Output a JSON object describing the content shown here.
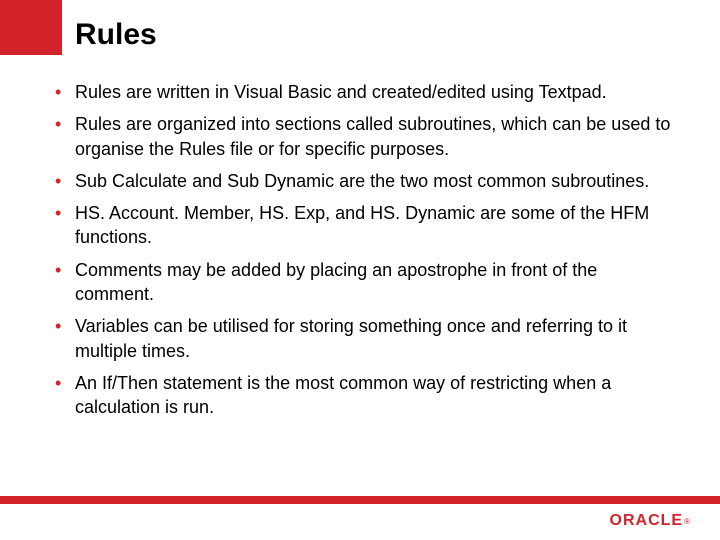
{
  "title": "Rules",
  "bullets": [
    "Rules are written in Visual Basic and created/edited using Textpad.",
    "Rules are organized into sections called subroutines, which can be used to organise the Rules file or for specific purposes.",
    "Sub Calculate and Sub Dynamic are the two most common subroutines.",
    "HS. Account. Member, HS. Exp, and HS. Dynamic are some of the HFM functions.",
    "Comments may be added by placing an apostrophe in front of the comment.",
    "Variables can be utilised for storing something once and referring to it multiple times.",
    "An If/Then statement is the most common way of restricting when a calculation is run."
  ],
  "logo": {
    "text": "ORACLE",
    "reg": "®"
  },
  "colors": {
    "accent": "#d2232a"
  }
}
